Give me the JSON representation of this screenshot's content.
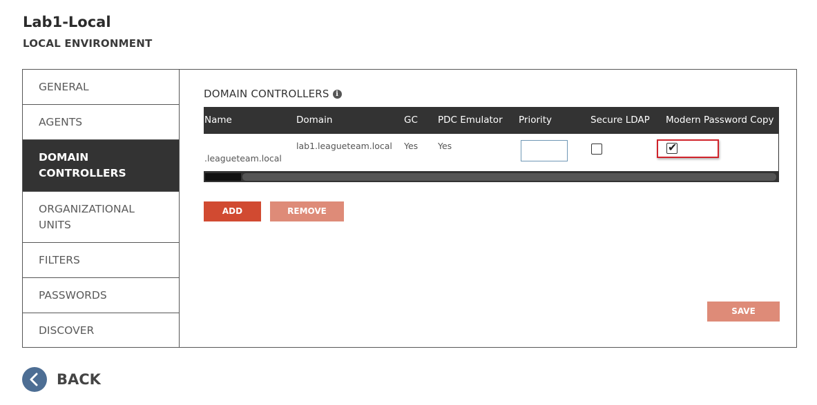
{
  "header": {
    "title": "Lab1-Local",
    "subtitle": "LOCAL ENVIRONMENT"
  },
  "side_nav": {
    "items": [
      {
        "label": "GENERAL",
        "active": false
      },
      {
        "label": "AGENTS",
        "active": false
      },
      {
        "label": "DOMAIN CONTROLLERS",
        "active": true
      },
      {
        "label": "ORGANIZATIONAL UNITS",
        "active": false
      },
      {
        "label": "FILTERS",
        "active": false
      },
      {
        "label": "PASSWORDS",
        "active": false
      },
      {
        "label": "DISCOVER",
        "active": false
      }
    ]
  },
  "section": {
    "title": "DOMAIN CONTROLLERS",
    "info_icon": "info-icon"
  },
  "table": {
    "columns": [
      "Name",
      "Domain",
      "GC",
      "PDC Emulator",
      "Priority",
      "Secure LDAP",
      "Modern Password Copy"
    ],
    "rows": [
      {
        "name": ".leagueteam.local",
        "domain": "lab1.leagueteam.local",
        "gc": "Yes",
        "pdc_emulator": "Yes",
        "priority": "",
        "secure_ldap": false,
        "modern_password_copy": true
      }
    ]
  },
  "buttons": {
    "add": "ADD",
    "remove": "REMOVE",
    "save": "SAVE"
  },
  "back": {
    "label": "BACK",
    "icon": "chevron-left-icon"
  },
  "colors": {
    "header_bg": "#333333",
    "active_nav_bg": "#333333",
    "primary_button": "#d14a31",
    "disabled_button": "#de8b78",
    "back_circle": "#4d6e94",
    "highlight": "#d0222a"
  }
}
